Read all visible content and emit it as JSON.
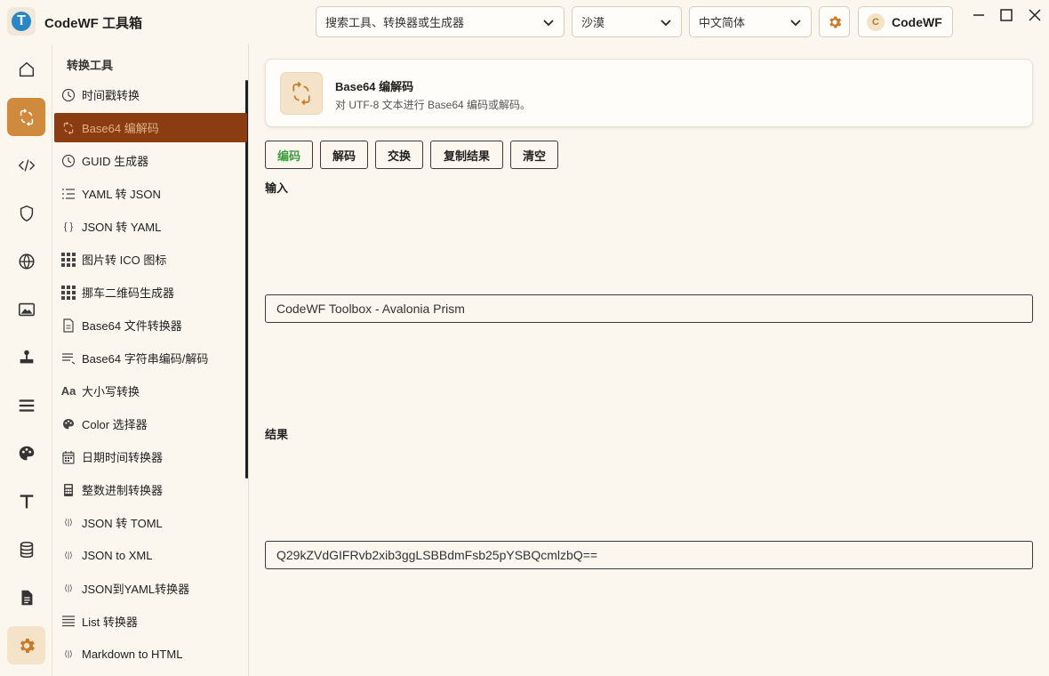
{
  "app": {
    "title": "CodeWF 工具箱",
    "logo_letter": "T"
  },
  "titlebar": {
    "search_placeholder": "搜索工具、转换器或生成器",
    "theme": "沙漠",
    "language": "中文简体",
    "user": {
      "name": "CodeWF",
      "avatar_letter": "C"
    }
  },
  "rail": {
    "items": [
      "home-icon",
      "convert-icon",
      "code-icon",
      "shield-icon",
      "globe-icon",
      "image-icon",
      "joystick-icon",
      "menu-icon",
      "palette-icon",
      "text-icon",
      "database-icon",
      "document-icon",
      "settings-icon"
    ],
    "active_index": 1
  },
  "nav": {
    "header": "转换工具",
    "items": [
      {
        "label": "时间戳转换",
        "icon": "clock-icon"
      },
      {
        "label": "Base64 编解码",
        "icon": "convert-icon"
      },
      {
        "label": "GUID 生成器",
        "icon": "clock-icon"
      },
      {
        "label": "YAML 转 JSON",
        "icon": "list-icon"
      },
      {
        "label": "JSON 转 YAML",
        "icon": "braces-icon"
      },
      {
        "label": "图片转 ICO 图标",
        "icon": "grid-icon"
      },
      {
        "label": "挪车二维码生成器",
        "icon": "grid-icon"
      },
      {
        "label": "Base64 文件转换器",
        "icon": "file-icon"
      },
      {
        "label": "Base64 字符串编码/解码",
        "icon": "lines-icon"
      },
      {
        "label": "大小写转换",
        "icon": "case-icon"
      },
      {
        "label": "Color 选择器",
        "icon": "palette-icon"
      },
      {
        "label": "日期时间转换器",
        "icon": "calendar-icon"
      },
      {
        "label": "整数进制转换器",
        "icon": "calculator-icon"
      },
      {
        "label": "JSON 转 TOML",
        "icon": "arrow-convert-icon"
      },
      {
        "label": "JSON to XML",
        "icon": "arrow-convert-icon"
      },
      {
        "label": "JSON到YAML转换器",
        "icon": "arrow-convert-icon"
      },
      {
        "label": "List 转换器",
        "icon": "list-icon"
      },
      {
        "label": "Markdown to HTML",
        "icon": "arrow-convert-icon"
      }
    ],
    "active_index": 1
  },
  "tool": {
    "title": "Base64 编解码",
    "description": "对 UTF-8 文本进行 Base64 编码或解码。",
    "buttons": {
      "encode": "编码",
      "decode": "解码",
      "swap": "交换",
      "copy": "复制结果",
      "clear": "清空"
    },
    "input_label": "输入",
    "input_value": "CodeWF Toolbox - Avalonia Prism",
    "result_label": "结果",
    "result_value": "Q29kZVdGIFRvb2xib3ggLSBBdmFsb25pYSBQcmlzbQ=="
  },
  "colors": {
    "accent": "#d08a3e",
    "nav_active_bg": "#8b3c10",
    "encode_green": "#3a9c3a",
    "background": "#fbf7ef"
  }
}
